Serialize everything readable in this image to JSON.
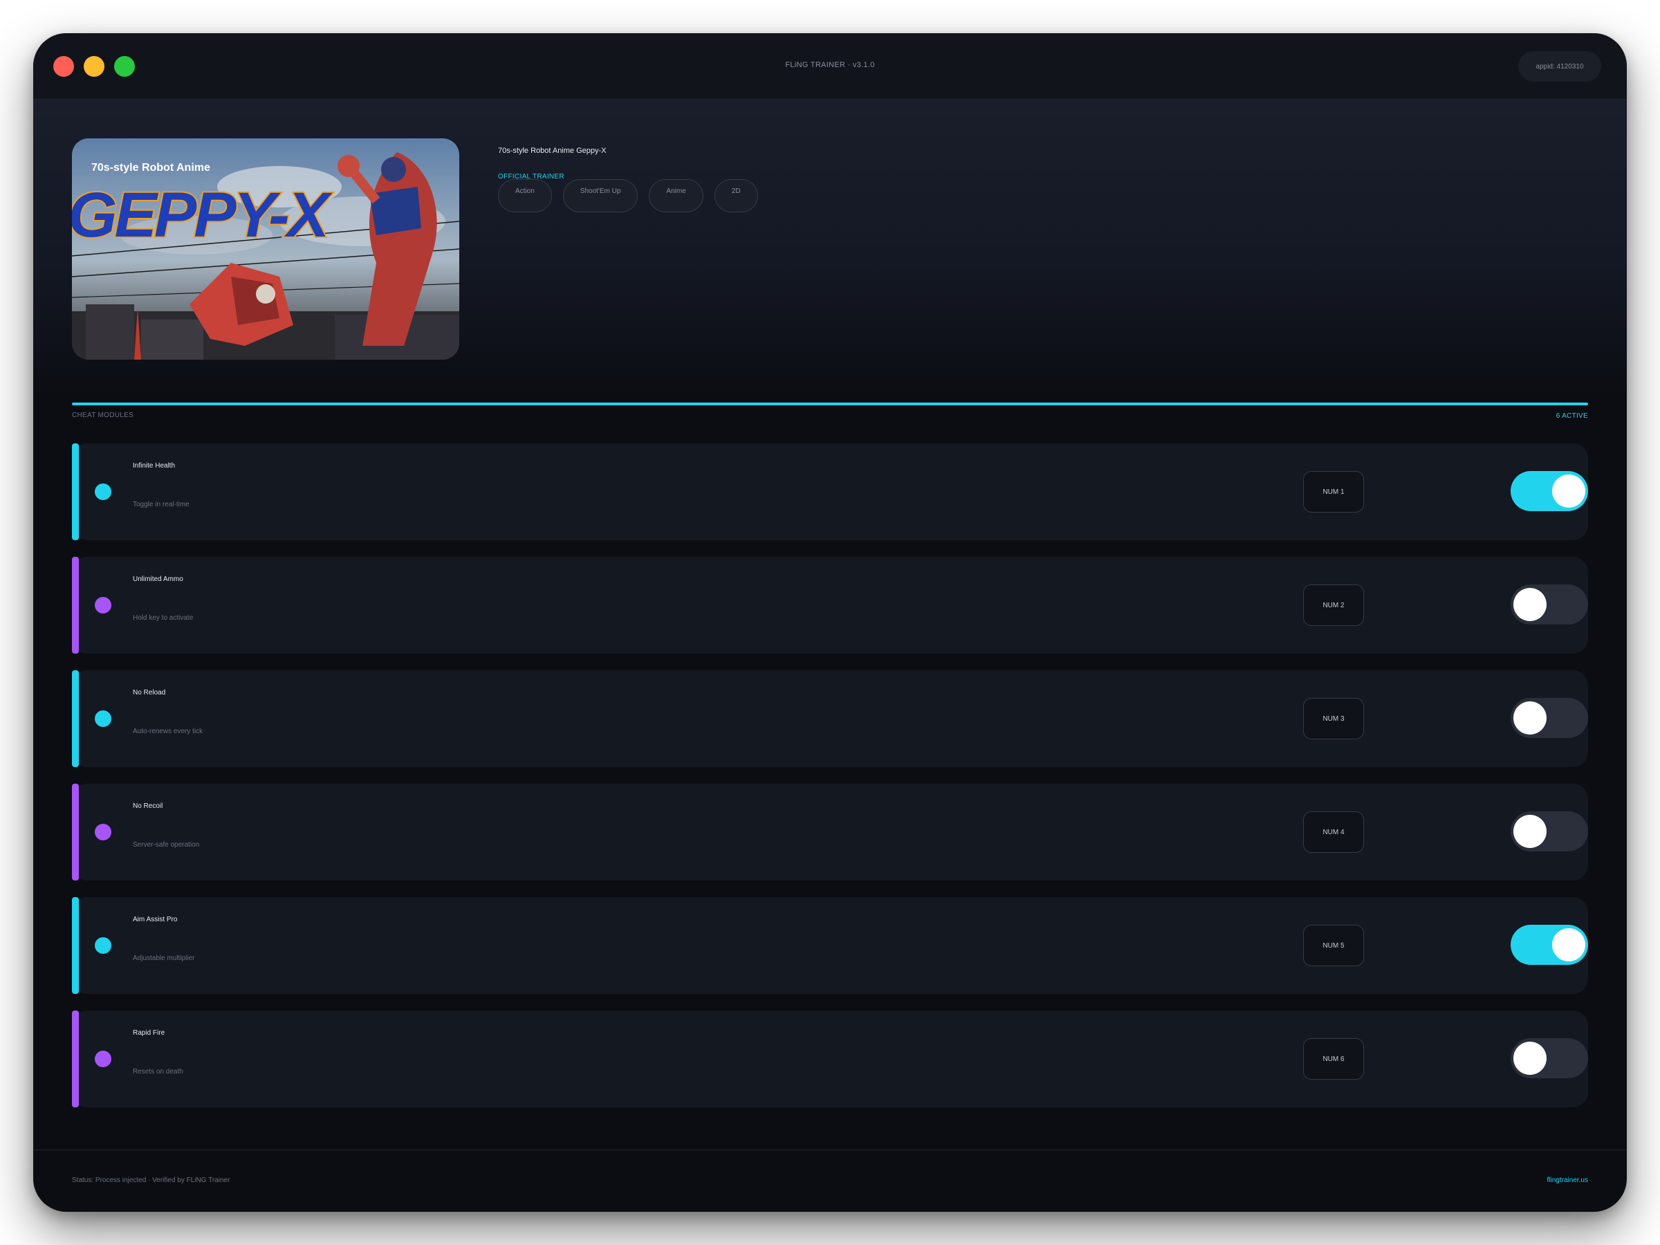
{
  "window": {
    "title": "FLiNG TRAINER · v3.1.0",
    "appid": "appid: 4120310"
  },
  "game": {
    "title": "70s-style Robot Anime Geppy-X",
    "badge": "OFFICIAL TRAINER",
    "cover_caption": "70s-style Robot Anime",
    "cover_logo": "GEPPY-X",
    "tags": [
      "Action",
      "Shoot'Em Up",
      "Anime",
      "2D"
    ]
  },
  "section": {
    "label": "CHEAT MODULES",
    "active": "6 ACTIVE"
  },
  "modules": [
    {
      "name": "Infinite Health",
      "desc": "Toggle in real-time",
      "key": "NUM 1",
      "on": true,
      "color": "#22d3ee"
    },
    {
      "name": "Unlimited Ammo",
      "desc": "Hold key to activate",
      "key": "NUM 2",
      "on": false,
      "color": "#a855f7"
    },
    {
      "name": "No Reload",
      "desc": "Auto-renews every tick",
      "key": "NUM 3",
      "on": false,
      "color": "#22d3ee"
    },
    {
      "name": "No Recoil",
      "desc": "Server-safe operation",
      "key": "NUM 4",
      "on": false,
      "color": "#a855f7"
    },
    {
      "name": "Aim Assist Pro",
      "desc": "Adjustable multiplier",
      "key": "NUM 5",
      "on": true,
      "color": "#22d3ee"
    },
    {
      "name": "Rapid Fire",
      "desc": "Resets on death",
      "key": "NUM 6",
      "on": false,
      "color": "#a855f7"
    }
  ],
  "footer": {
    "status": "Status: Process injected · Verified by FLiNG Trainer",
    "link": "flingtrainer.us"
  },
  "colors": {
    "accent": "#22d3ee",
    "secondary": "#a855f7",
    "background": "#0b0d12"
  }
}
